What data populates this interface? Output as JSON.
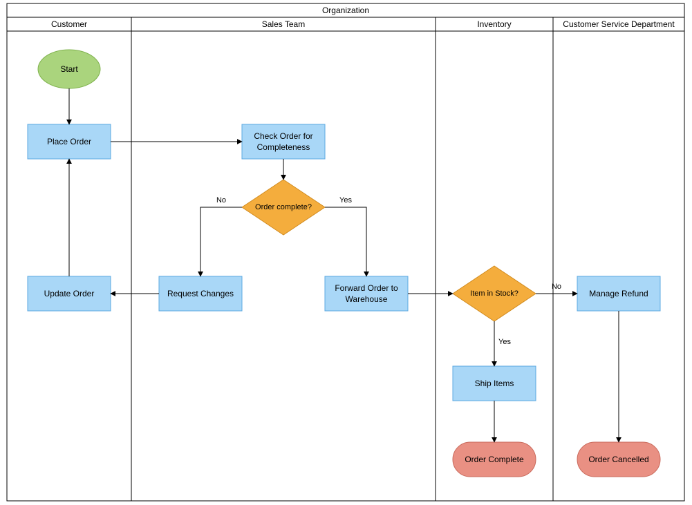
{
  "pool": {
    "title": "Organization"
  },
  "lanes": {
    "customer": "Customer",
    "sales": "Sales Team",
    "inventory": "Inventory",
    "csd": "Customer Service Department"
  },
  "nodes": {
    "start": "Start",
    "place_order": "Place Order",
    "check_order": "Check Order for\nCompleteness",
    "order_complete_q": "Order complete?",
    "request_changes": "Request Changes",
    "update_order": "Update Order",
    "forward_order": "Forward Order to\nWarehouse",
    "item_in_stock_q": "Item in Stock?",
    "ship_items": "Ship Items",
    "order_complete_end": "Order Complete",
    "manage_refund": "Manage Refund",
    "order_cancelled_end": "Order Cancelled"
  },
  "edges": {
    "no": "No",
    "yes": "Yes",
    "yes2": "Yes",
    "no2": "No"
  }
}
